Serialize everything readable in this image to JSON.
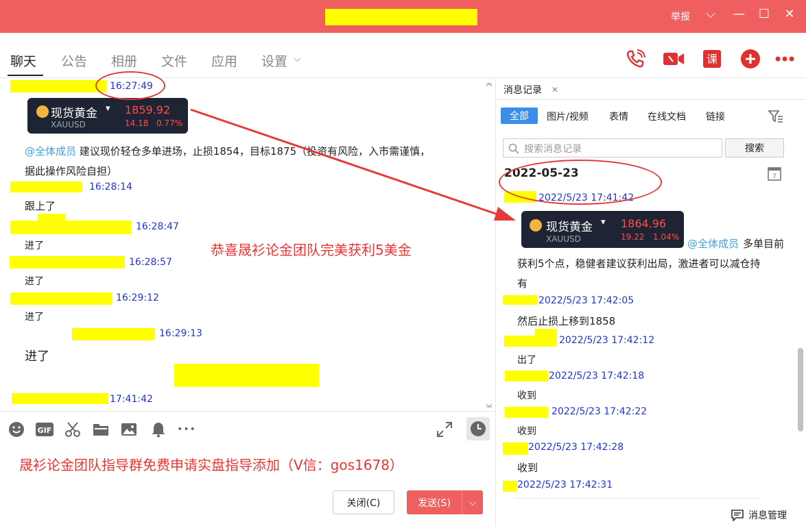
{
  "titlebar": {
    "report": "举报",
    "min": "—",
    "max": "☐",
    "close": "✕",
    "menu": "⌵"
  },
  "nav": {
    "tabs": [
      "聊天",
      "公告",
      "相册",
      "文件",
      "应用",
      "设置"
    ],
    "settings_arrow": "⌵"
  },
  "chat": {
    "messages": [
      {
        "time": "16:27:49"
      },
      {
        "card": {
          "name": "现货黄金",
          "arrow": "▾",
          "symbol": "XAUUSD",
          "price": "1859.92",
          "change": "14.18",
          "pct": "0.77%"
        }
      },
      {
        "mention": "@全体成员",
        "text_a": " 建议现价轻仓多单进场，止损1854，目标1875（投资有风险，入市需谨慎，",
        "text_b": "据此操作风险自担）"
      },
      {
        "time": "16:28:14",
        "text": "跟上了"
      },
      {
        "time": "16:28:47",
        "text": "进了"
      },
      {
        "time": "16:28:57",
        "text": "进了"
      },
      {
        "time": "16:29:12",
        "text": "进了"
      },
      {
        "time": "16:29:13",
        "text": "进了"
      },
      {
        "time": "17:41:42"
      }
    ],
    "overlay_text": "恭喜晟衫论金团队完美获利5美金",
    "input_text": "晟衫论金团队指导群免费申请实盘指导添加（V信：gos1678）"
  },
  "toolbar": {
    "gif": "GIF",
    "more": "•••"
  },
  "buttons": {
    "close": "关闭(C)",
    "send": "发送(S)",
    "send_arrow": "⌵"
  },
  "history": {
    "tab": "消息记录",
    "tab_close": "✕",
    "filters": [
      "全部",
      "图片/视频",
      "表情",
      "在线文档",
      "链接"
    ],
    "search_placeholder": "搜索消息记录",
    "search_button": "搜索",
    "date": "2022-05-23",
    "entries": [
      {
        "time": "2022/5/23 17:41:42"
      },
      {
        "card": {
          "name": "现货黄金",
          "arrow": "▾",
          "symbol": "XAUUSD",
          "price": "1864.96",
          "change": "19.22",
          "pct": "1.04%"
        },
        "mention": "@全体成员",
        "text_a": " 多单目前",
        "text_b": "获利5个点，稳健者建议获利出局，激进者可以减仓持",
        "text_c": "有"
      },
      {
        "time": "2022/5/23 17:42:05",
        "text": "然后止损上移到1858"
      },
      {
        "time": "2022/5/23 17:42:12",
        "text": "出了"
      },
      {
        "time": "2022/5/23 17:42:18",
        "text": "收到"
      },
      {
        "time": "2022/5/23 17:42:22",
        "text": "收到"
      },
      {
        "time": "2022/5/23 17:42:28",
        "text": "收到"
      },
      {
        "time": "2022/5/23 17:42:31"
      }
    ],
    "manage": "消息管理"
  },
  "colors": {
    "brand": "#f05f5f",
    "accent": "#3a8ee6",
    "highlight": "#ffff00",
    "annotation": "#e63a3a"
  }
}
